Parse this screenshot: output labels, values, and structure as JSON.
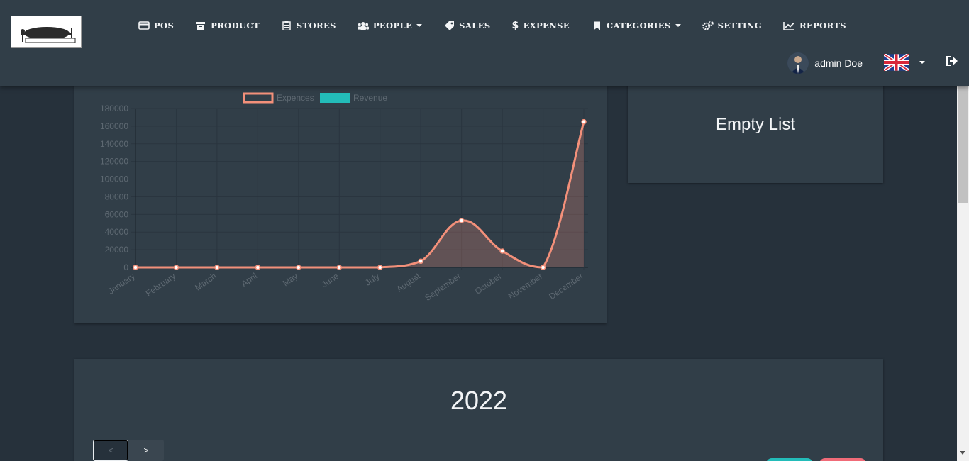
{
  "app": {
    "logo_text": "Restaurant"
  },
  "nav": {
    "items": [
      {
        "label": "POS",
        "icon": "credit-card-icon",
        "dropdown": false
      },
      {
        "label": "PRODUCT",
        "icon": "archive-icon",
        "dropdown": false
      },
      {
        "label": "STORES",
        "icon": "clipboard-icon",
        "dropdown": false
      },
      {
        "label": "PEOPLE",
        "icon": "users-icon",
        "dropdown": true
      },
      {
        "label": "SALES",
        "icon": "tag-icon",
        "dropdown": false
      },
      {
        "label": "EXPENSE",
        "icon": "dollar-icon",
        "dropdown": false
      },
      {
        "label": "CATEGORIES",
        "icon": "bookmark-icon",
        "dropdown": true
      },
      {
        "label": "SETTING",
        "icon": "cogs-icon",
        "dropdown": false
      },
      {
        "label": "REPORTS",
        "icon": "line-chart-icon",
        "dropdown": false
      }
    ]
  },
  "user": {
    "name": "admin Doe",
    "language_flag": "uk-flag-icon"
  },
  "empty_panel": {
    "text": "Empty List"
  },
  "year_panel": {
    "year": "2022",
    "prev_label": "<",
    "next_label": ">"
  },
  "colors": {
    "expenses": "#f3907a",
    "revenue": "#23bcb9",
    "background": "#26313b",
    "card": "#313e48"
  },
  "chart_data": {
    "type": "line",
    "categories": [
      "January",
      "February",
      "March",
      "April",
      "May",
      "June",
      "July",
      "August",
      "September",
      "October",
      "November",
      "December"
    ],
    "series": [
      {
        "name": "Expences",
        "values": [
          0,
          0,
          0,
          0,
          0,
          0,
          0,
          7000,
          53000,
          18500,
          0,
          165000
        ]
      },
      {
        "name": "Revenue",
        "values": []
      }
    ],
    "yticks": [
      0,
      20000,
      40000,
      60000,
      80000,
      100000,
      120000,
      140000,
      160000,
      180000
    ],
    "ylim": [
      0,
      180000
    ],
    "legend": "top",
    "grid": true
  }
}
